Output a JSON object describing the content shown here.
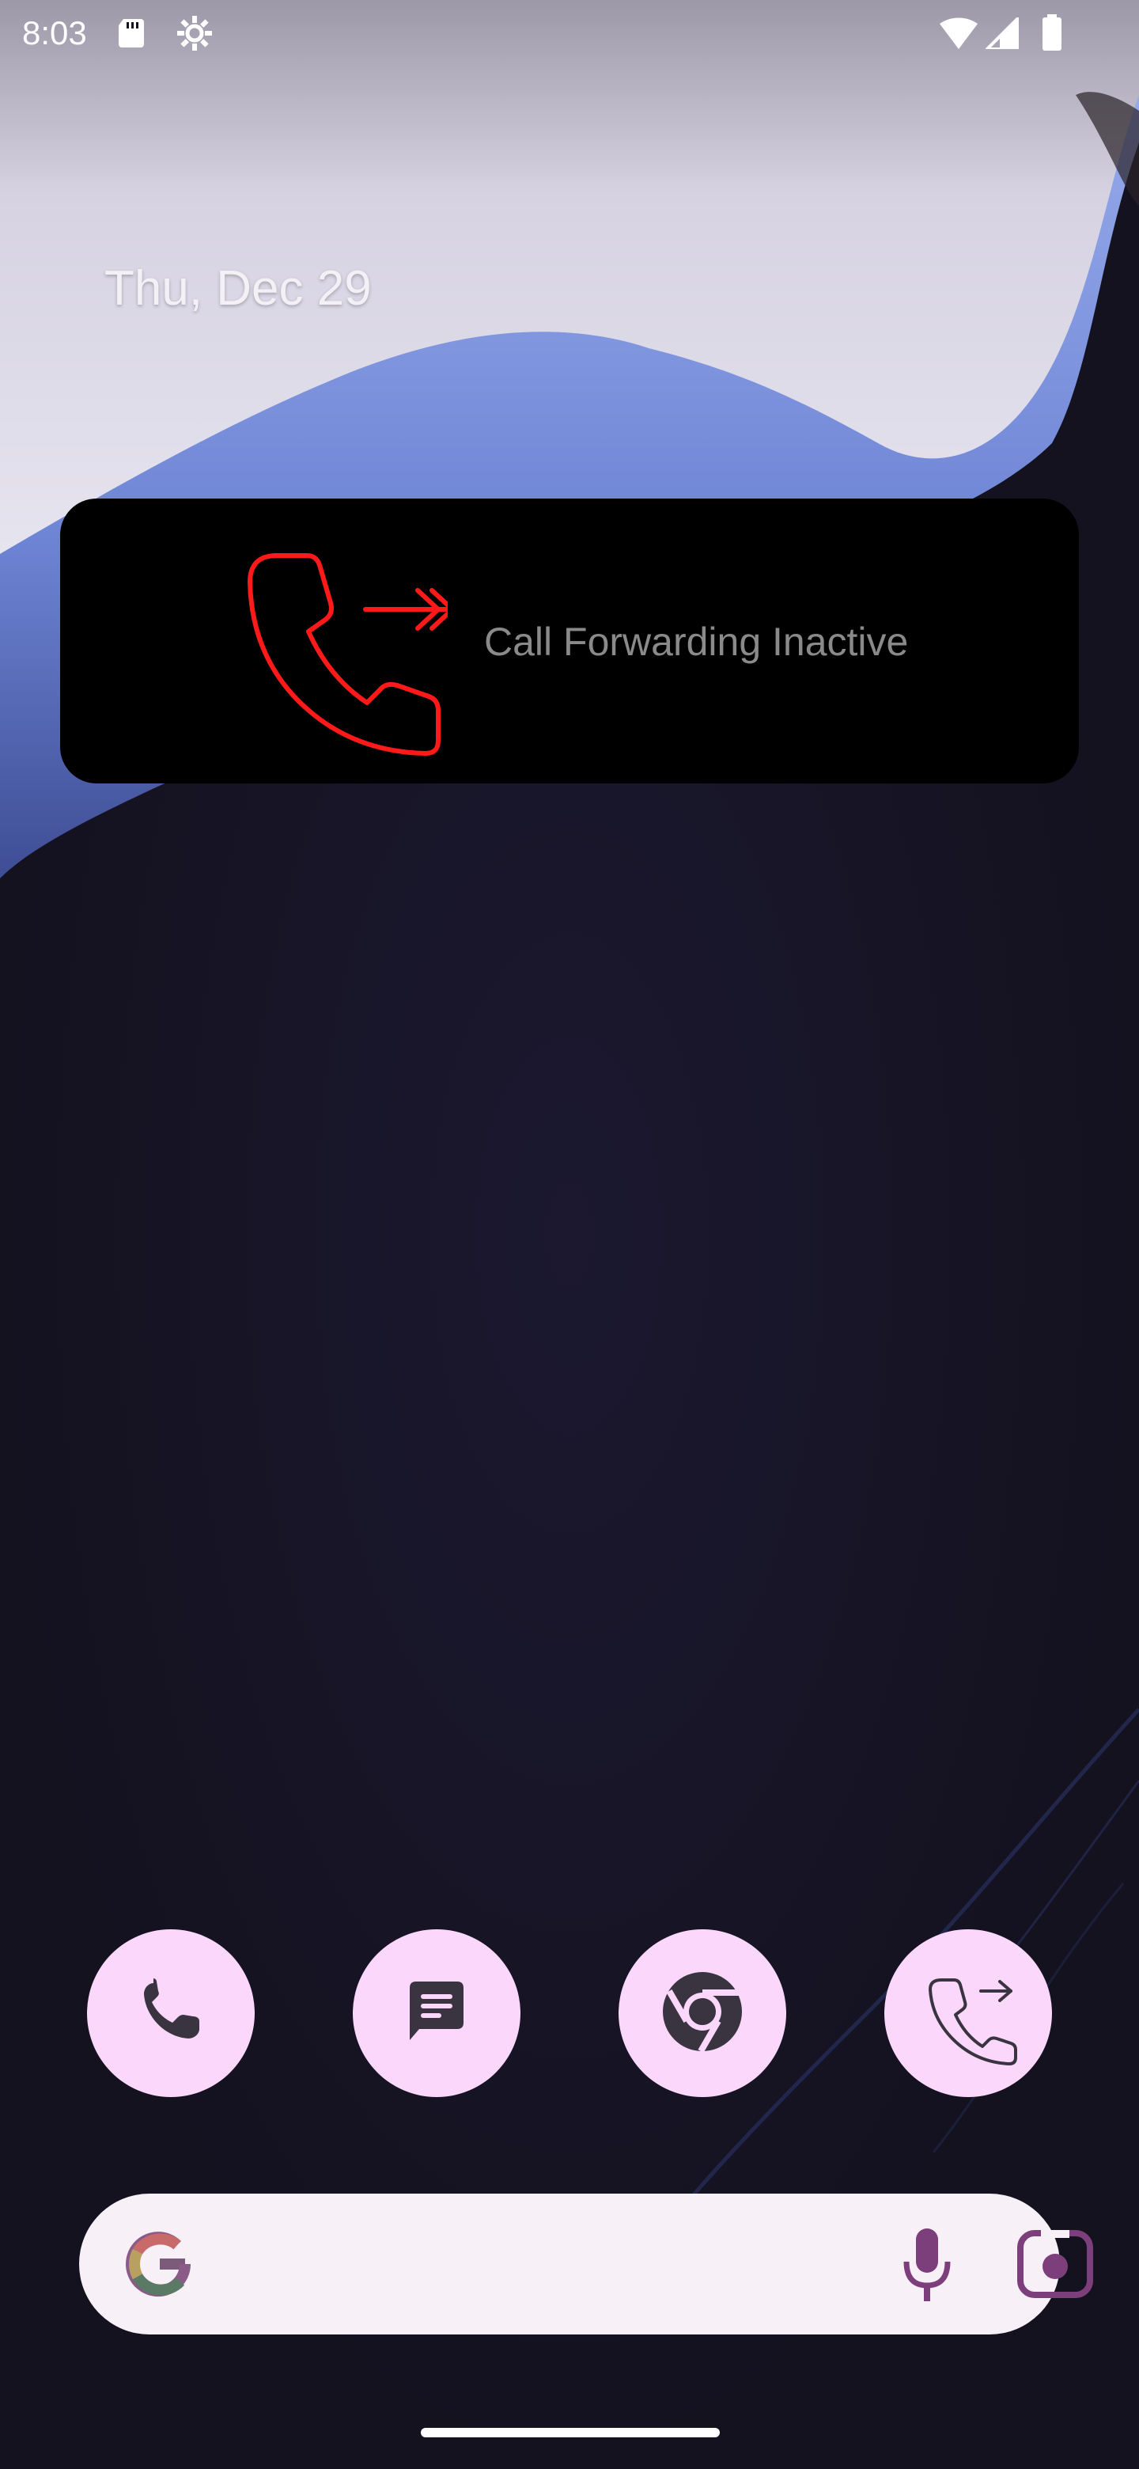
{
  "status_bar": {
    "time": "8:03",
    "icons": [
      "sd-card-icon",
      "settings-gear-icon",
      "wifi-icon",
      "cellular-signal-icon",
      "battery-icon"
    ]
  },
  "home": {
    "date": "Thu, Dec 29"
  },
  "widget": {
    "icon": "call-forward-icon",
    "status_text": "Call Forwarding Inactive",
    "accent_color": "#ff1a1a",
    "text_color": "#8a8a8a"
  },
  "dock": {
    "apps": [
      {
        "name": "Phone",
        "icon": "phone-icon"
      },
      {
        "name": "Messages",
        "icon": "messages-icon"
      },
      {
        "name": "Chrome",
        "icon": "chrome-icon"
      },
      {
        "name": "Call Forwarding",
        "icon": "call-forward-icon"
      }
    ],
    "icon_bg_color": "#fbd8fb",
    "icon_fg_color": "#3a3440"
  },
  "search": {
    "left_icon": "google-g-icon",
    "right_icons": [
      "microphone-icon",
      "camera-lens-icon"
    ],
    "bar_color": "#f7f0f7"
  }
}
